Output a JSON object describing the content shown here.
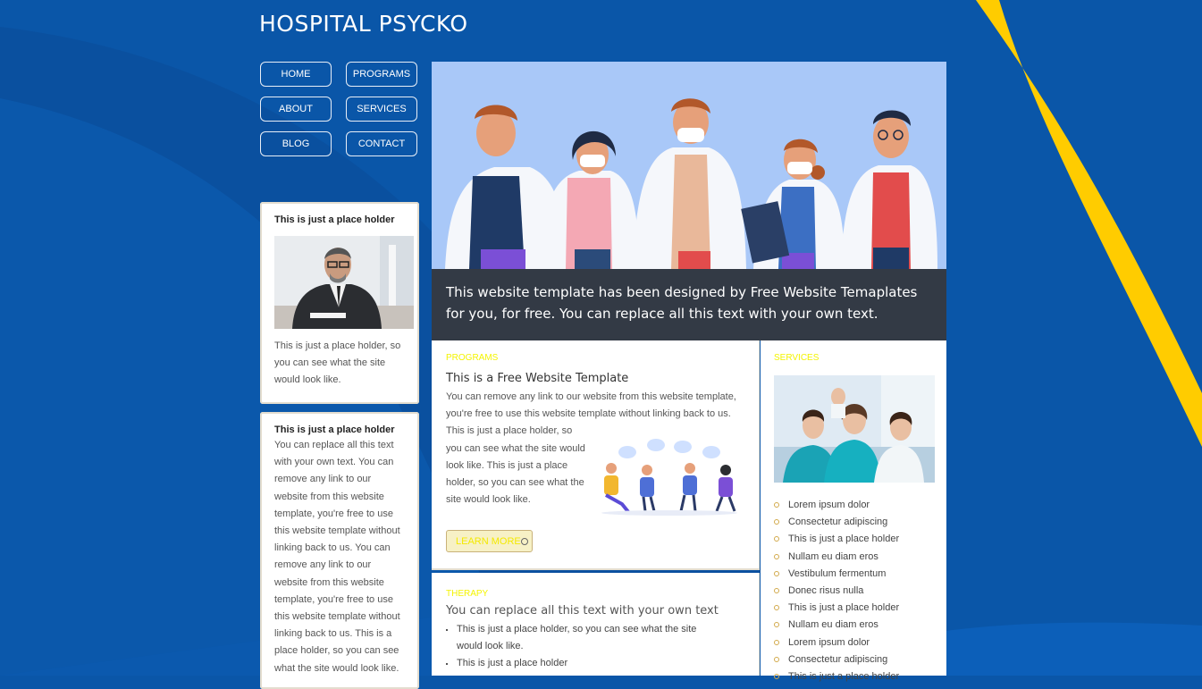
{
  "site": {
    "title": "HOSPITAL PSYCKO"
  },
  "nav": {
    "items": [
      {
        "label": "HOME"
      },
      {
        "label": "PROGRAMS"
      },
      {
        "label": "ABOUT"
      },
      {
        "label": "SERVICES"
      },
      {
        "label": "BLOG"
      },
      {
        "label": "CONTACT"
      }
    ]
  },
  "sidebar": {
    "card1": {
      "title": "This is just a place holder",
      "text": "This is just a place holder, so you can see what the site would look like."
    },
    "card2": {
      "title": "This is just a place holder",
      "text": "You can replace all this text with your own text. You can remove any link to our website from this website template, you're free to use this website template without linking back to us. You can remove any link to our website from this website template, you're free to use this website template without linking back to us. This is a place holder, so you can see what the site would look like."
    }
  },
  "hero": {
    "caption": "This website template has been designed by Free Website Temaplates for you, for free. You can replace all this text with your own text."
  },
  "programs": {
    "label": "PROGRAMS",
    "heading": "This is a Free Website Template",
    "paragraph1": "You can remove any link to our website from this website template, you're free to use this website template without linking back to us.",
    "paragraph2": "This is just a place holder, so you can see what the site would look like. This is just a place holder, so you can see what the site would look like.",
    "button_label": "LEARN MORE"
  },
  "therapy": {
    "label": "THERAPY",
    "heading": "You can replace all this text with your own text",
    "items": [
      "This is just a place holder, so you can see what the site would look like.",
      "This is just a place holder"
    ]
  },
  "services": {
    "label": "SERVICES",
    "items": [
      "Lorem ipsum dolor",
      "Consectetur adipiscing",
      "This is just a place holder",
      "Nullam eu diam eros",
      "Vestibulum fermentum",
      "Donec risus nulla",
      "This is just a place holder",
      "Nullam eu diam eros",
      "Lorem ipsum dolor",
      "Consectetur adipiscing",
      "This is just a place holder"
    ]
  },
  "colors": {
    "background": "#0a56a8",
    "accent_yellow": "#ffcc00",
    "caption_bar": "#333a45",
    "hero_bg": "#a9c8f8",
    "section_label": "#f4f400",
    "bullet": "#d2a94a"
  }
}
